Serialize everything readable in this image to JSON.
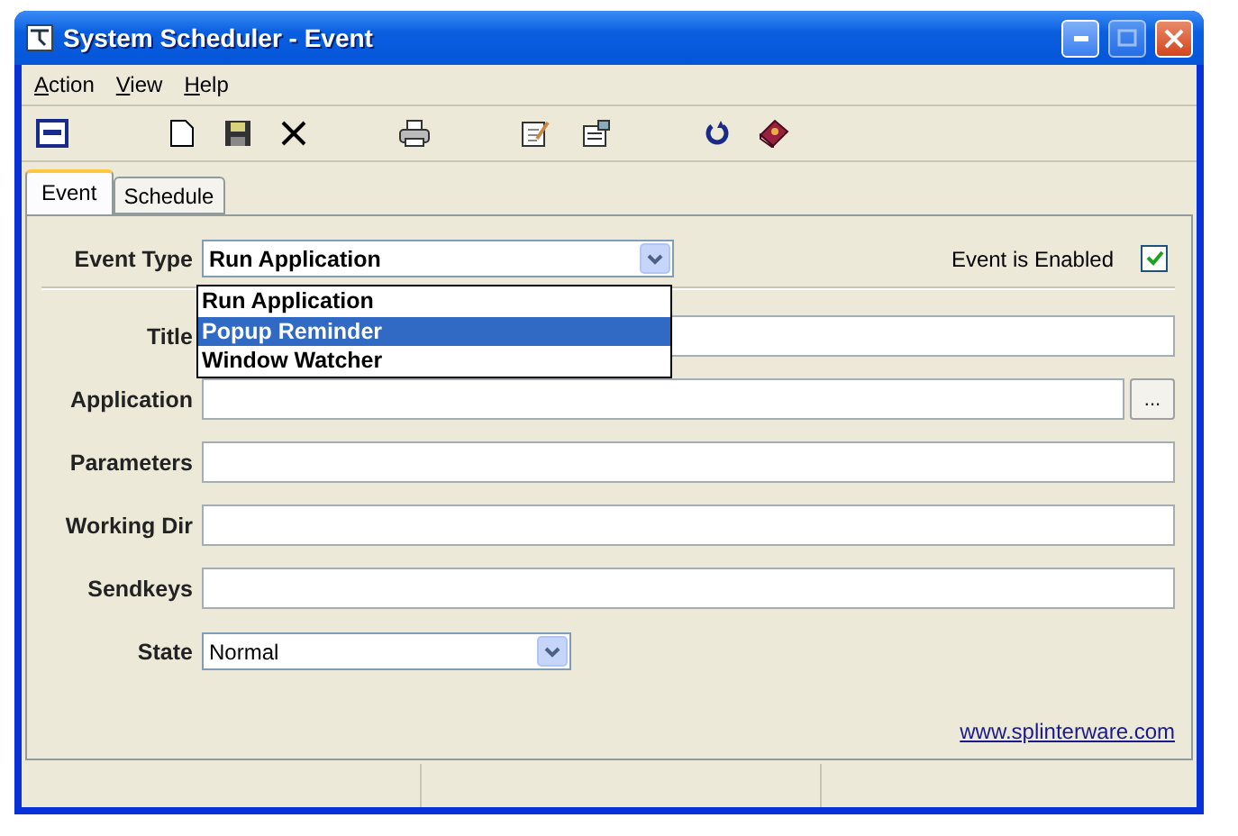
{
  "window": {
    "title": "System Scheduler - Event"
  },
  "menu": [
    {
      "label": "Action"
    },
    {
      "label": "View"
    },
    {
      "label": "Help"
    }
  ],
  "tabs": [
    {
      "label": "Event",
      "selected": true
    },
    {
      "label": "Schedule",
      "selected": false
    }
  ],
  "event_type": {
    "label": "Event Type",
    "value": "Run Application",
    "expanded": true,
    "options": [
      {
        "label": "Run Application",
        "highlighted": false
      },
      {
        "label": "Popup Reminder",
        "highlighted": true
      },
      {
        "label": "Window Watcher",
        "highlighted": false
      }
    ]
  },
  "enabled": {
    "label": "Event is Enabled",
    "checked": true
  },
  "fields": [
    {
      "label": "Title",
      "kind": "text"
    },
    {
      "label": "Application",
      "kind": "browse",
      "button": "..."
    },
    {
      "label": "Parameters",
      "kind": "text"
    },
    {
      "label": "Working Dir",
      "kind": "text"
    },
    {
      "label": "Sendkeys",
      "kind": "text"
    }
  ],
  "state": {
    "label": "State",
    "value": "Normal"
  },
  "link": "www.splinterware.com"
}
